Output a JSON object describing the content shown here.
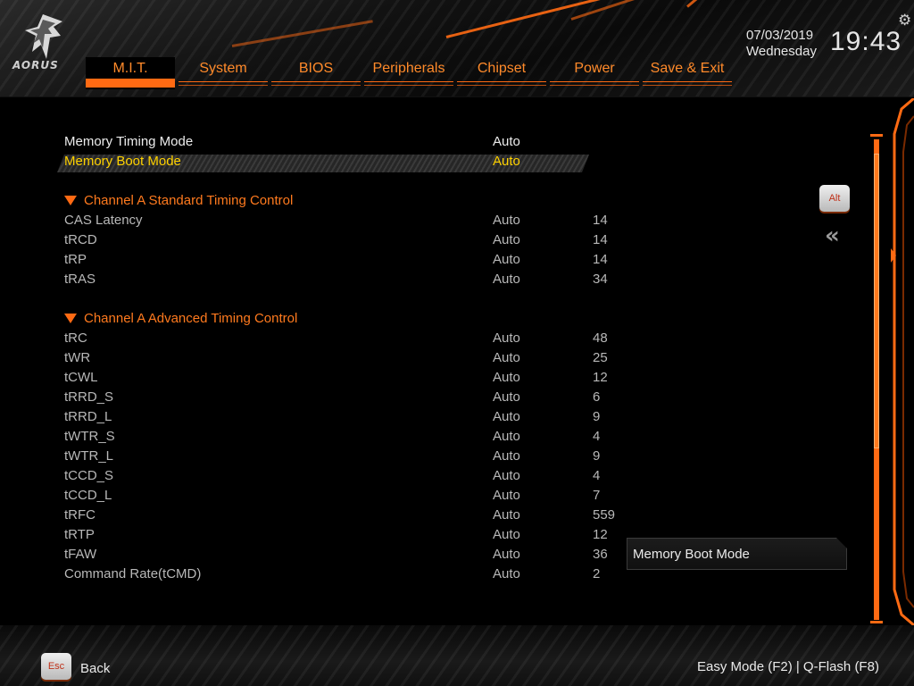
{
  "brand": {
    "logo_text": "AORUS"
  },
  "nav": {
    "tabs": [
      {
        "label": "M.I.T."
      },
      {
        "label": "System"
      },
      {
        "label": "BIOS"
      },
      {
        "label": "Peripherals"
      },
      {
        "label": "Chipset"
      },
      {
        "label": "Power"
      },
      {
        "label": "Save & Exit"
      }
    ]
  },
  "clock": {
    "date": "07/03/2019",
    "day": "Wednesday",
    "time": "19:43"
  },
  "settings": {
    "memory_timing_mode": {
      "label": "Memory Timing Mode",
      "value": "Auto"
    },
    "memory_boot_mode": {
      "label": "Memory Boot Mode",
      "value": "Auto"
    },
    "section_standard": "Channel A Standard Timing Control",
    "standard": [
      {
        "label": "CAS Latency",
        "value": "Auto",
        "current": "14"
      },
      {
        "label": "tRCD",
        "value": "Auto",
        "current": "14"
      },
      {
        "label": "tRP",
        "value": "Auto",
        "current": "14"
      },
      {
        "label": "tRAS",
        "value": "Auto",
        "current": "34"
      }
    ],
    "section_advanced": "Channel A Advanced Timing Control",
    "advanced": [
      {
        "label": "tRC",
        "value": "Auto",
        "current": "48"
      },
      {
        "label": "tWR",
        "value": "Auto",
        "current": "25"
      },
      {
        "label": "tCWL",
        "value": "Auto",
        "current": "12"
      },
      {
        "label": "tRRD_S",
        "value": "Auto",
        "current": "6"
      },
      {
        "label": "tRRD_L",
        "value": "Auto",
        "current": "9"
      },
      {
        "label": "tWTR_S",
        "value": "Auto",
        "current": "4"
      },
      {
        "label": "tWTR_L",
        "value": "Auto",
        "current": "9"
      },
      {
        "label": "tCCD_S",
        "value": "Auto",
        "current": "4"
      },
      {
        "label": "tCCD_L",
        "value": "Auto",
        "current": "7"
      },
      {
        "label": "tRFC",
        "value": "Auto",
        "current": "559"
      },
      {
        "label": "tRTP",
        "value": "Auto",
        "current": "12"
      },
      {
        "label": "tFAW",
        "value": "Auto",
        "current": "36"
      },
      {
        "label": "Command Rate(tCMD)",
        "value": "Auto",
        "current": "2"
      }
    ]
  },
  "widgets": {
    "alt_key": "Alt",
    "collapse_icon": "double-chevron-left"
  },
  "help": {
    "text": "Memory Boot Mode"
  },
  "footer": {
    "esc_key": "Esc",
    "back_label": "Back",
    "right_text": "Easy Mode (F2)  |  Q-Flash (F8)"
  },
  "colors": {
    "accent": "#ff6a13",
    "selected_text": "#ffd200",
    "section": "#ff7a1e"
  }
}
